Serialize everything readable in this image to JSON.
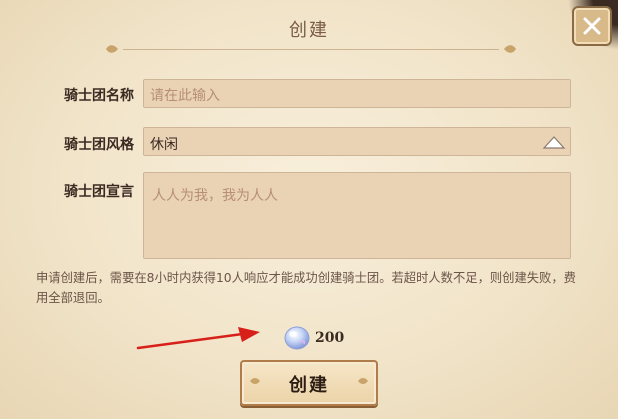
{
  "dialog": {
    "title": "创建",
    "close_icon": "close-icon"
  },
  "form": {
    "name": {
      "label": "骑士团名称",
      "placeholder": "请在此输入",
      "value": ""
    },
    "style": {
      "label": "骑士团风格",
      "selected": "休闲",
      "toggle_icon": "triangle-up-icon"
    },
    "declaration": {
      "label": "骑士团宣言",
      "placeholder": "人人为我，我为人人"
    }
  },
  "note": "申请创建后，需要在8小时内获得10人响应才能成功创建骑士团。若超时人数不足，则创建失败，费用全部退回。",
  "cost": {
    "icon": "crystal-gem-icon",
    "amount": "200"
  },
  "actions": {
    "create_label": "创建"
  },
  "colors": {
    "panel": "#f1e4c9",
    "field": "#ead2b5",
    "accent_arrow": "#d8201a",
    "text_dark": "#3b2a22"
  }
}
